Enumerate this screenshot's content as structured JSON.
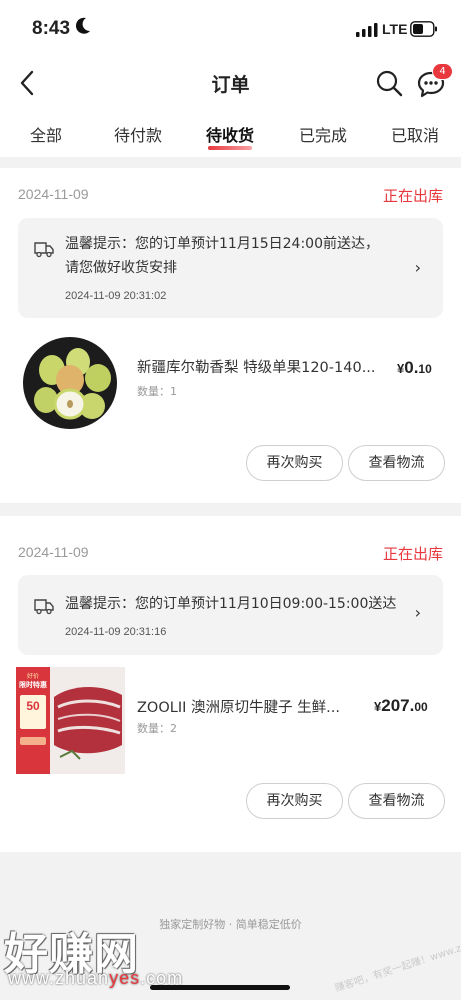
{
  "status_bar": {
    "time": "8:43",
    "network": "LTE"
  },
  "nav": {
    "title": "订单",
    "badge_count": "4"
  },
  "tabs": [
    {
      "label": "全部"
    },
    {
      "label": "待付款"
    },
    {
      "label": "待收货"
    },
    {
      "label": "已完成"
    },
    {
      "label": "已取消"
    }
  ],
  "active_tab": "待收货",
  "orders": [
    {
      "date": "2024-11-09",
      "status": "正在出库",
      "notice_line1": "温馨提示：您的订单预计11月15日24:00前送达，",
      "notice_line2": "请您做好收货安排",
      "notice_time": "2024-11-09 20:31:02",
      "product_name": "新疆库尔勒香梨 特级单果120-140...",
      "quantity": "数量：1",
      "price_currency": "¥",
      "price_int": "0.",
      "price_dec": "10",
      "btn_rebuy": "再次购买",
      "btn_logistics": "查看物流"
    },
    {
      "date": "2024-11-09",
      "status": "正在出库",
      "notice_line1": "温馨提示：您的订单预计11月10日09:00-15:00送达",
      "notice_time": "2024-11-09 20:31:16",
      "product_name": "ZOOLII 澳洲原切牛腱子 生鲜...",
      "quantity": "数量：2",
      "price_currency": "¥",
      "price_int": "207.",
      "price_dec": "00",
      "btn_rebuy": "再次购买",
      "btn_logistics": "查看物流",
      "thumb_badge_top": "好价",
      "thumb_badge_title": "限时特惠",
      "thumb_coupon_amount": "50"
    }
  ],
  "footer": {
    "slogan": "独家定制好物 · 简单稳定低价"
  },
  "watermark": {
    "logo": "好赚网",
    "url_prefix": "www.zhuan",
    "url_highlight": "yes",
    "url_suffix": ".com",
    "diag": "赚客吧，有奖一起赚！www.zuanke8.com"
  },
  "colors": {
    "accent": "#e8383d",
    "background": "#f2f2f2"
  }
}
